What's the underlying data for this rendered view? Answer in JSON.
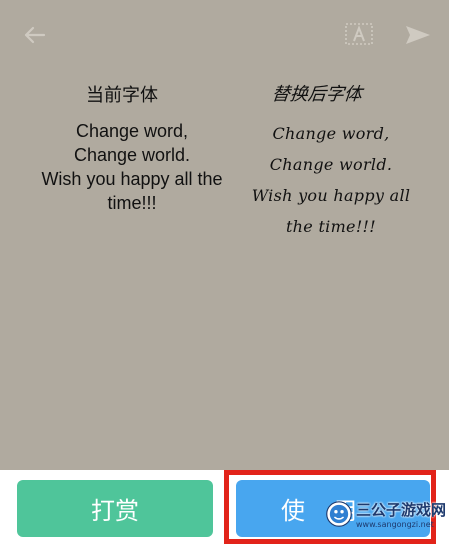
{
  "preview": {
    "before_heading": "当前字体",
    "after_heading": "替换后字体",
    "before_lines": [
      "Change word,",
      "Change world.",
      "Wish you happy all the",
      "time!!!"
    ],
    "after_lines": [
      "Change word,",
      "Change world.",
      "Wish you happy all",
      "the time!!!"
    ],
    "background_color": "#b0aa9f"
  },
  "topbar": {
    "back_icon": "arrow-left-icon",
    "font_icon": "font-a-icon",
    "send_icon": "send-icon"
  },
  "actions": {
    "tip_label": "打赏",
    "tip_color": "#4fc59a",
    "use_label": "使用",
    "use_color": "#48a6ef",
    "highlight_color": "#e2231a"
  },
  "watermark": {
    "name": "三公子游戏网",
    "url": "www.sangongzi.net"
  }
}
